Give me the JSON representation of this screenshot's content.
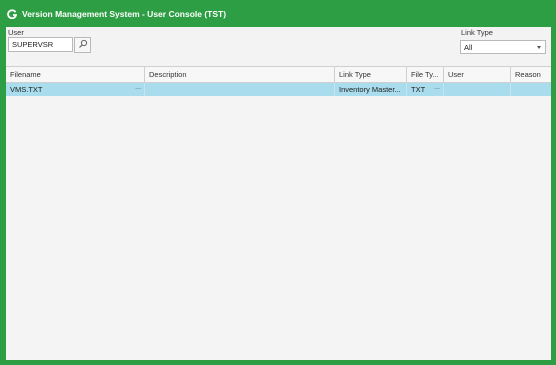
{
  "window": {
    "title": "Version Management System - User Console (TST)"
  },
  "filters": {
    "user_label": "User",
    "user_value": "SUPERVSR",
    "link_type_label": "Link Type",
    "link_type_value": "All"
  },
  "grid": {
    "columns": [
      "Filename",
      "Description",
      "Link Type",
      "File Ty...",
      "User",
      "Reason"
    ],
    "rows": [
      {
        "filename": "VMS.TXT",
        "description": "",
        "link_type": "Inventory Master...",
        "file_type": "TXT",
        "user": "",
        "reason": ""
      }
    ]
  },
  "icons": {
    "app": "app-logo-icon",
    "search": "search-icon",
    "dropdown": "chevron-down-icon",
    "ellipsis": "ellipsis-icon"
  },
  "colors": {
    "frame": "#2e9e44",
    "selection": "#a9dcec",
    "title_text": "#ffffff"
  }
}
